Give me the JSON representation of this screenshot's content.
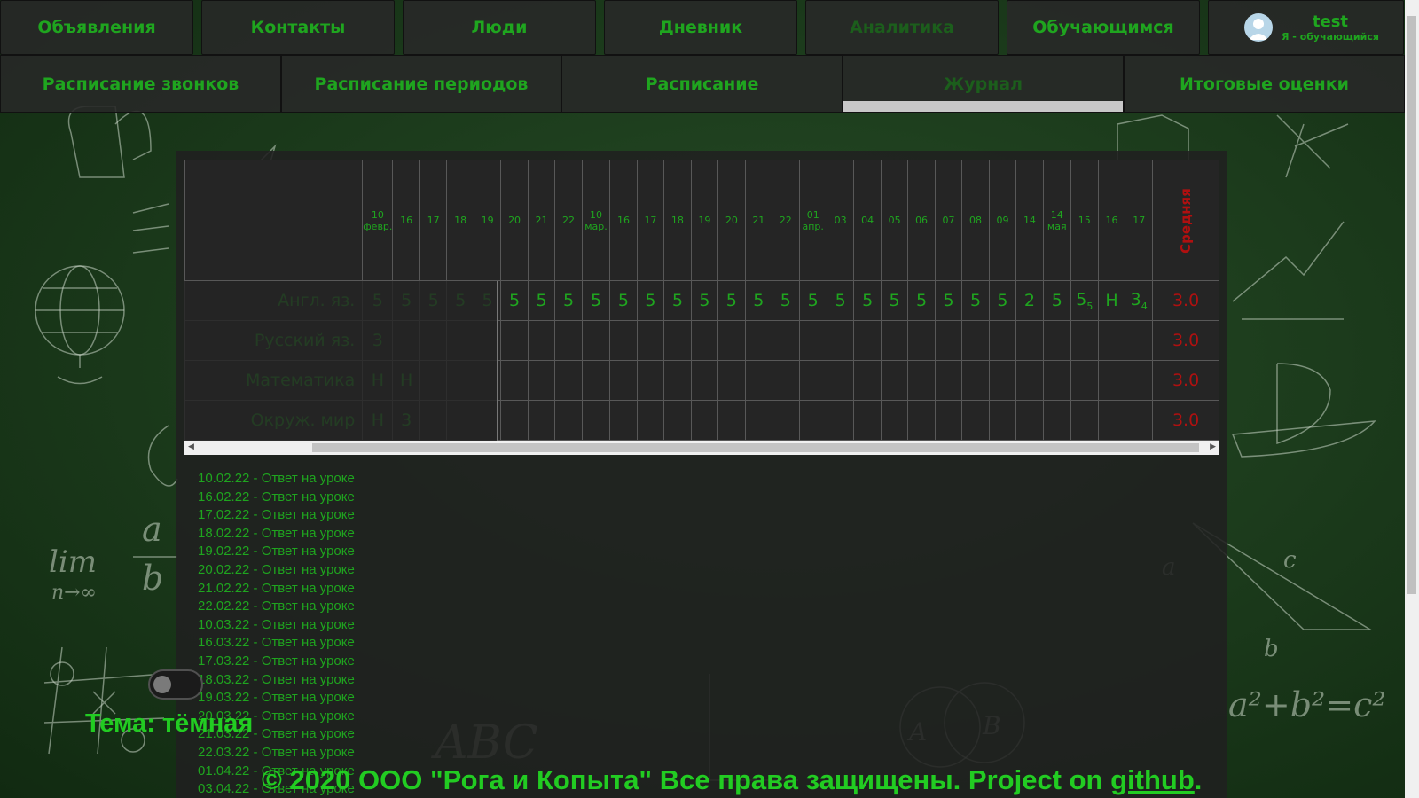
{
  "nav_top": [
    {
      "label": "Объявления"
    },
    {
      "label": "Контакты"
    },
    {
      "label": "Люди"
    },
    {
      "label": "Дневник"
    },
    {
      "label": "Аналитика"
    },
    {
      "label": "Обучающимся"
    }
  ],
  "user": {
    "name": "test",
    "role": "Я - обучающийся"
  },
  "nav_bottom": [
    {
      "label": "Расписание звонков"
    },
    {
      "label": "Расписание периодов"
    },
    {
      "label": "Расписание"
    },
    {
      "label": "Журнал"
    },
    {
      "label": "Итоговые оценки"
    }
  ],
  "journal": {
    "dates": [
      [
        "10",
        "февр."
      ],
      [
        "16"
      ],
      [
        "17"
      ],
      [
        "18"
      ],
      [
        "19"
      ],
      [
        "20"
      ],
      [
        "21"
      ],
      [
        "22"
      ],
      [
        "10",
        "мар."
      ],
      [
        "16"
      ],
      [
        "17"
      ],
      [
        "18"
      ],
      [
        "19"
      ],
      [
        "20"
      ],
      [
        "21"
      ],
      [
        "22"
      ],
      [
        "01",
        "апр."
      ],
      [
        "03"
      ],
      [
        "04"
      ],
      [
        "05"
      ],
      [
        "06"
      ],
      [
        "07"
      ],
      [
        "08"
      ],
      [
        "09"
      ],
      [
        "14"
      ],
      [
        "14",
        "мая"
      ],
      [
        "15"
      ],
      [
        "16"
      ],
      [
        "17"
      ]
    ],
    "average_header": "Средняя",
    "rows": [
      {
        "subject": "Англ. яз.",
        "marks": [
          "5",
          "5",
          "5",
          "5",
          "5",
          "5",
          "5",
          "5",
          "5",
          "5",
          "5",
          "5",
          "5",
          "5",
          "5",
          "5",
          "5",
          "5",
          "5",
          "5",
          "5",
          "5",
          "5",
          "5",
          "2",
          "5",
          "5|5",
          "Н",
          "3|4"
        ],
        "average": "3.0"
      },
      {
        "subject": "Русский яз.",
        "marks": [
          "3",
          "",
          "",
          "",
          "",
          "",
          "",
          "",
          "",
          "",
          "",
          "",
          "",
          "",
          "",
          "",
          "",
          "",
          "",
          "",
          "",
          "",
          "",
          "",
          "",
          "",
          "",
          "",
          ""
        ],
        "average": "3.0"
      },
      {
        "subject": "Математика",
        "marks": [
          "Н",
          "Н",
          "",
          "",
          "",
          "",
          "",
          "",
          "",
          "",
          "",
          "",
          "",
          "",
          "",
          "",
          "",
          "",
          "",
          "",
          "",
          "",
          "",
          "",
          "",
          "",
          "",
          "",
          ""
        ],
        "average": "3.0"
      },
      {
        "subject": "Окруж. мир",
        "marks": [
          "Н",
          "3",
          "",
          "",
          "",
          "",
          "",
          "",
          "",
          "",
          "",
          "",
          "",
          "",
          "",
          "",
          "",
          "",
          "",
          "",
          "",
          "",
          "",
          "",
          "",
          "",
          "",
          "",
          ""
        ],
        "average": "3.0"
      }
    ]
  },
  "log": [
    "10.02.22 - Ответ на уроке",
    "16.02.22 - Ответ на уроке",
    "17.02.22 - Ответ на уроке",
    "18.02.22 - Ответ на уроке",
    "19.02.22 - Ответ на уроке",
    "20.02.22 - Ответ на уроке",
    "21.02.22 - Ответ на уроке",
    "22.02.22 - Ответ на уроке",
    "10.03.22 - Ответ на уроке",
    "16.03.22 - Ответ на уроке",
    "17.03.22 - Ответ на уроке",
    "18.03.22 - Ответ на уроке",
    "19.03.22 - Ответ на уроке",
    "20.03.22 - Ответ на уроке",
    "21.03.22 - Ответ на уроке",
    "22.03.22 - Ответ на уроке",
    "01.04.22 - Ответ на уроке",
    "03.04.22 - Ответ на уроке"
  ],
  "theme": {
    "label": "Тема: тёмная"
  },
  "footer": {
    "text": "© 2020 ООО \"Рога и Копыта\" Все права защищены. Project on ",
    "link": "github",
    "end": "."
  },
  "colors": {
    "accent_green": "#1fa51f",
    "average_red": "#b01010",
    "background_green": "#1d3d1d"
  },
  "icons": {
    "avatar": "user-avatar-icon",
    "scroll_left": "arrow-left-icon",
    "scroll_right": "arrow-right-icon"
  }
}
